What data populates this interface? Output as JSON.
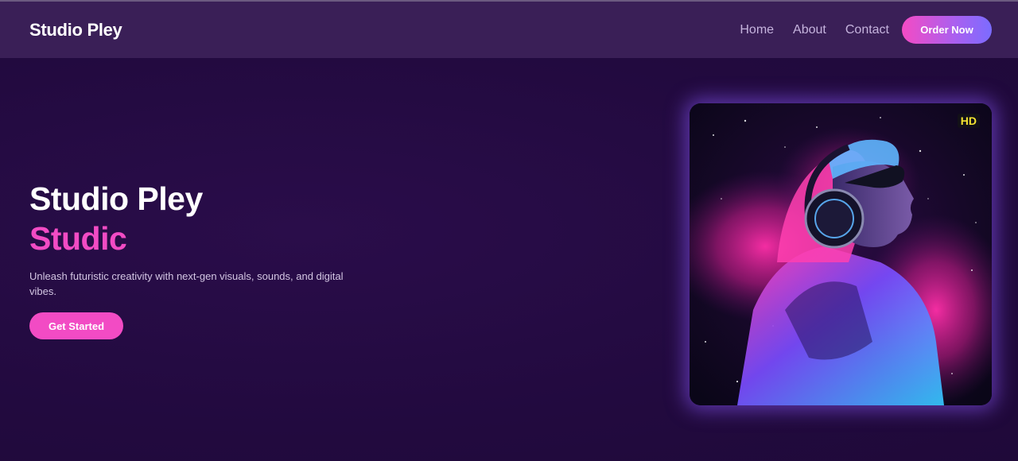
{
  "header": {
    "brand": "Studio Pley",
    "nav": [
      "Home",
      "About",
      "Contact"
    ],
    "order_button": "Order Now"
  },
  "hero": {
    "title": "Studio Pley",
    "subtitle": "Studic",
    "description": "Unleash futuristic creativity with next-gen visuals, sounds, and digital vibes.",
    "cta": "Get Started"
  },
  "media": {
    "badge": "HD",
    "image": "neon-portrait-with-headphones"
  },
  "colors": {
    "background": "#220a3f",
    "header": "#3a1f57",
    "accent_pink": "#f24bc4",
    "accent_purple": "#7b6cff",
    "badge_text": "#f5e431"
  }
}
